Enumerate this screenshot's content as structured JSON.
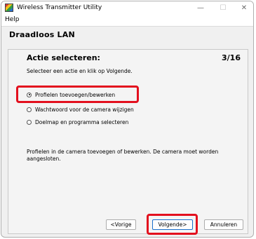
{
  "window": {
    "title": "Wireless Transmitter Utility",
    "controls": {
      "minimize": "—",
      "maximize": "☐",
      "close": "✕"
    }
  },
  "menu": {
    "help": "Help"
  },
  "header": {
    "title": "Draadloos LAN"
  },
  "panel": {
    "heading": "Actie selecteren:",
    "step": "3/16",
    "instruction": "Selecteer een actie en klik op Volgende.",
    "options": [
      {
        "label": "Profielen toevoegen/bewerken",
        "selected": true
      },
      {
        "label": "Wachtwoord voor de camera wijzigen",
        "selected": false
      },
      {
        "label": "Doelmap en programma selecteren",
        "selected": false
      }
    ],
    "description": "Profielen in de camera toevoegen of bewerken. De camera moet worden aangesloten."
  },
  "buttons": {
    "prev": "<Vorige",
    "next": "Volgende>",
    "cancel": "Annuleren"
  },
  "colors": {
    "highlight": "#e3101e",
    "default_button_border": "#1a6fcc"
  }
}
